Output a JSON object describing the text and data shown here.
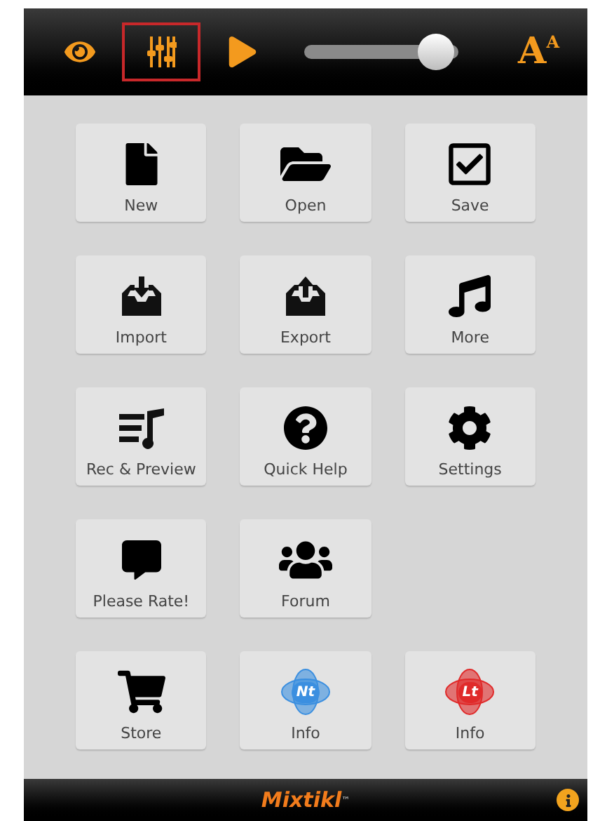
{
  "toolbar": {
    "tools": [
      {
        "kind": "eye",
        "selected": false
      },
      {
        "kind": "mixer",
        "selected": true
      },
      {
        "kind": "play",
        "selected": false
      }
    ],
    "slider": {
      "level": 0.85
    },
    "font_button": {
      "big": "A",
      "small": "A"
    }
  },
  "tile_rows": [
    [
      {
        "kind": "icon",
        "label": "New"
      },
      {
        "kind": "icon",
        "label": "Open"
      },
      {
        "kind": "icon",
        "label": "Save"
      }
    ],
    [
      {
        "kind": "icon",
        "label": "Import"
      },
      {
        "kind": "icon",
        "label": "Export"
      },
      {
        "kind": "icon",
        "label": "More"
      }
    ],
    [
      {
        "kind": "icon",
        "label": "Rec & Preview"
      },
      {
        "kind": "icon",
        "label": "Quick Help"
      },
      {
        "kind": "icon",
        "label": "Settings"
      }
    ],
    [
      {
        "kind": "icon",
        "label": "Please Rate!"
      },
      {
        "kind": "icon",
        "label": "Forum"
      }
    ],
    [
      {
        "kind": "icon",
        "label": "Store"
      },
      {
        "kind": "badge",
        "label": "Info",
        "badge": "Nt",
        "color": "#3b8fe0"
      },
      {
        "kind": "badge",
        "label": "Info",
        "badge": "Lt",
        "color": "#e02a2a"
      }
    ]
  ],
  "footer": {
    "logo": "Mixtikl",
    "trademark": "™"
  }
}
